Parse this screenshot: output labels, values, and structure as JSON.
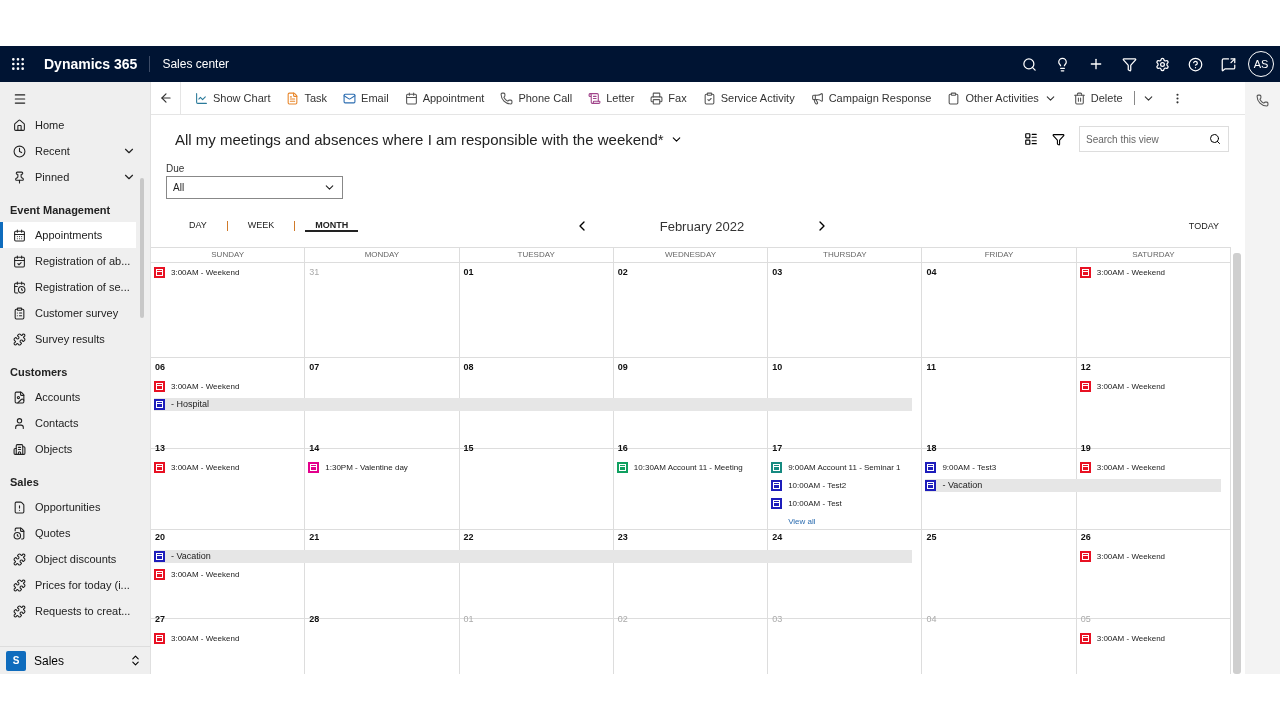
{
  "topbar": {
    "app_name": "Dynamics 365",
    "area": "Sales center",
    "avatar": "AS"
  },
  "sidebar": {
    "nav": [
      {
        "label": "Home"
      },
      {
        "label": "Recent",
        "expanded": false
      },
      {
        "label": "Pinned",
        "expanded": false
      }
    ],
    "sections": [
      {
        "title": "Event Management",
        "items": [
          {
            "label": "Appointments",
            "selected": true
          },
          {
            "label": "Registration of ab...",
            "selected": false
          },
          {
            "label": "Registration of se...",
            "selected": false
          },
          {
            "label": "Customer survey",
            "selected": false
          },
          {
            "label": "Survey results",
            "selected": false
          }
        ]
      },
      {
        "title": "Customers",
        "items": [
          {
            "label": "Accounts",
            "selected": false
          },
          {
            "label": "Contacts",
            "selected": false
          },
          {
            "label": "Objects",
            "selected": false
          }
        ]
      },
      {
        "title": "Sales",
        "items": [
          {
            "label": "Opportunities",
            "selected": false
          },
          {
            "label": "Quotes",
            "selected": false
          },
          {
            "label": "Object discounts",
            "selected": false
          },
          {
            "label": "Prices for today (i...",
            "selected": false
          },
          {
            "label": "Requests to creat...",
            "selected": false
          }
        ]
      }
    ],
    "area_switcher": {
      "badge": "S",
      "label": "Sales"
    }
  },
  "commands": [
    {
      "label": "Show Chart",
      "kind": "plain"
    },
    {
      "label": "Task",
      "kind": "plain"
    },
    {
      "label": "Email",
      "kind": "plain"
    },
    {
      "label": "Appointment",
      "kind": "plain"
    },
    {
      "label": "Phone Call",
      "kind": "plain"
    },
    {
      "label": "Letter",
      "kind": "plain"
    },
    {
      "label": "Fax",
      "kind": "plain"
    },
    {
      "label": "Service Activity",
      "kind": "plain"
    },
    {
      "label": "Campaign Response",
      "kind": "plain"
    },
    {
      "label": "Other Activities",
      "kind": "menu"
    },
    {
      "label": "Delete",
      "kind": "split"
    }
  ],
  "view": {
    "title": "All my meetings and absences where I am responsible with the weekend*",
    "search": {
      "placeholder": "Search this view"
    },
    "filter": {
      "label": "Due",
      "value": "All"
    }
  },
  "calendar": {
    "views": [
      {
        "label": "DAY",
        "selected": false
      },
      {
        "label": "WEEK",
        "selected": false
      },
      {
        "label": "MONTH",
        "selected": true
      }
    ],
    "month": "February 2022",
    "today": "TODAY",
    "weekdays": [
      "SUNDAY",
      "MONDAY",
      "TUESDAY",
      "WEDNESDAY",
      "THURSDAY",
      "FRIDAY",
      "SATURDAY"
    ],
    "weeks": [
      {
        "days": [
          {
            "events": [
              {
                "kind": "event",
                "text": "3:00AM - Weekend",
                "color": "#e81123"
              }
            ]
          },
          {
            "date": "31",
            "muted": true
          },
          {
            "date": "01",
            "muted": false
          },
          {
            "date": "02",
            "muted": false
          },
          {
            "date": "03",
            "muted": false
          },
          {
            "date": "04",
            "muted": false
          },
          {
            "events": [
              {
                "kind": "event",
                "text": "3:00AM - Weekend",
                "color": "#e81123"
              }
            ]
          }
        ]
      },
      {
        "days": [
          {
            "date": "06",
            "muted": false,
            "events": [
              {
                "kind": "event",
                "text": "3:00AM - Weekend",
                "color": "#e81123"
              },
              {
                "kind": "band",
                "text": "- Hospital",
                "color": "#1d1dbb"
              }
            ]
          },
          {
            "date": "07",
            "muted": false,
            "events": [
              {
                "kind": "continued"
              }
            ]
          },
          {
            "date": "08",
            "muted": false,
            "events": [
              {
                "kind": "continued"
              }
            ]
          },
          {
            "date": "09",
            "muted": false,
            "events": [
              {
                "kind": "continued"
              }
            ]
          },
          {
            "date": "10",
            "muted": false,
            "events": [
              {
                "kind": "continued"
              }
            ]
          },
          {
            "date": "11",
            "muted": false
          },
          {
            "date": "12",
            "muted": false,
            "events": [
              {
                "kind": "event",
                "text": "3:00AM - Weekend",
                "color": "#e81123"
              }
            ]
          }
        ]
      },
      {
        "days": [
          {
            "date": "13",
            "muted": false,
            "events": [
              {
                "kind": "event",
                "text": "3:00AM - Weekend",
                "color": "#e81123"
              }
            ]
          },
          {
            "date": "14",
            "muted": false,
            "events": [
              {
                "kind": "event",
                "text": "1:30PM - Valentine day",
                "color": "#e3008c"
              }
            ]
          },
          {
            "date": "15",
            "muted": false
          },
          {
            "date": "16",
            "muted": false,
            "events": [
              {
                "kind": "event",
                "text": "10:30AM Account 11 - Meeting",
                "color": "#10a060"
              }
            ]
          },
          {
            "date": "17",
            "muted": false,
            "events": [
              {
                "kind": "event",
                "text": "9:00AM Account 11 - Seminar 1",
                "color": "#168a80"
              },
              {
                "kind": "event",
                "text": "10:00AM - Test2",
                "color": "#1d1dbb"
              },
              {
                "kind": "event",
                "text": "10:00AM - Test",
                "color": "#1d1dbb"
              },
              {
                "kind": "link",
                "text": "View all"
              }
            ]
          },
          {
            "date": "18",
            "muted": false,
            "events": [
              {
                "kind": "event",
                "text": "9:00AM - Test3",
                "color": "#1d1dbb"
              },
              {
                "kind": "band",
                "text": "- Vacation",
                "color": "#1d1dbb"
              }
            ]
          },
          {
            "date": "19",
            "muted": false,
            "events": [
              {
                "kind": "event",
                "text": "3:00AM - Weekend",
                "color": "#e81123"
              },
              {
                "kind": "continued"
              }
            ]
          }
        ]
      },
      {
        "days": [
          {
            "date": "20",
            "muted": false,
            "events": [
              {
                "kind": "band",
                "text": "- Vacation",
                "color": "#1d1dbb"
              },
              {
                "kind": "event",
                "text": "3:00AM - Weekend",
                "color": "#e81123"
              }
            ]
          },
          {
            "date": "21",
            "muted": false,
            "events": [
              {
                "kind": "continued"
              }
            ]
          },
          {
            "date": "22",
            "muted": false,
            "events": [
              {
                "kind": "continued"
              }
            ]
          },
          {
            "date": "23",
            "muted": false,
            "events": [
              {
                "kind": "continued"
              }
            ]
          },
          {
            "date": "24",
            "muted": false,
            "events": [
              {
                "kind": "continued"
              }
            ]
          },
          {
            "date": "25",
            "muted": false
          },
          {
            "date": "26",
            "muted": false,
            "events": [
              {
                "kind": "event",
                "text": "3:00AM - Weekend",
                "color": "#e81123"
              }
            ]
          }
        ]
      },
      {
        "days": [
          {
            "date": "27",
            "muted": false,
            "events": [
              {
                "kind": "event",
                "text": "3:00AM - Weekend",
                "color": "#e81123"
              }
            ]
          },
          {
            "date": "28",
            "muted": false
          },
          {
            "date": "01",
            "muted": true
          },
          {
            "date": "02",
            "muted": true
          },
          {
            "date": "03",
            "muted": true
          },
          {
            "date": "04",
            "muted": true
          },
          {
            "date": "05",
            "muted": true,
            "events": [
              {
                "kind": "event",
                "text": "3:00AM - Weekend",
                "color": "#e81123"
              }
            ]
          }
        ]
      }
    ]
  }
}
